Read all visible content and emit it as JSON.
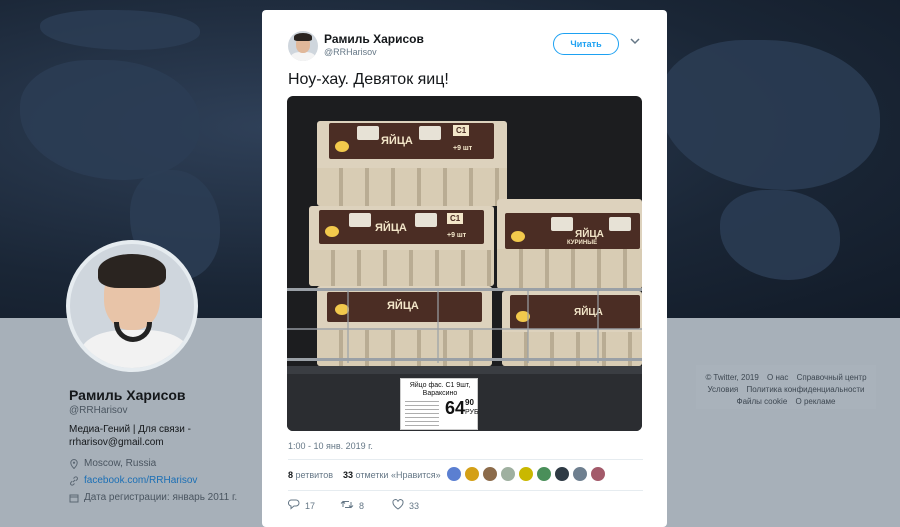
{
  "profile": {
    "name": "Рамиль Харисов",
    "handle": "@RRHarisov",
    "bio": "Медиа-Гений | Для связи - rrharisov@gmail.com",
    "location": "Moscow, Russia",
    "link": "facebook.com/RRHarisov",
    "joined": "Дата регистрации: январь 2011 г.",
    "icons": {
      "location": "location-pin-icon",
      "link": "link-icon",
      "joined": "calendar-icon"
    }
  },
  "footer": {
    "copyright": "© Twitter, 2019",
    "about": "О нас",
    "help": "Справочный центр",
    "terms": "Условия",
    "privacy": "Политика конфиденциальности",
    "cookies": "Файлы cookie",
    "ads": "О рекламе"
  },
  "tweet": {
    "author_name": "Рамиль Харисов",
    "author_handle": "@RRHarisov",
    "follow_label": "Читать",
    "menu_icon": "chevron-down-icon",
    "text": "Ноу-хау. Девяток яиц!",
    "timestamp": "1:00 - 10 янв. 2019 г.",
    "retweets_count": "8",
    "retweets_label": "ретвитов",
    "likes_count": "33",
    "likes_label": "отметки «Нравится»",
    "reply_count": "17",
    "retweet_count": "8",
    "like_count": "33",
    "liker_colors": [
      "#5b7fd1",
      "#d4a017",
      "#8c6b4a",
      "#9fb0a0",
      "#c9b800",
      "#4a8f5a",
      "#2e3a44",
      "#6e7f8f",
      "#a35a6a"
    ]
  },
  "photo": {
    "label_word": "ЯЙЦА",
    "label_sub": "КУРИНЫЕ",
    "grade": "С1",
    "count_badge": "+9 шт",
    "price_tag_name": "Яйцо фас. С1 9шт, Вараксино",
    "price_rub": "64",
    "price_kop": "90",
    "price_unit": "РУБ"
  }
}
